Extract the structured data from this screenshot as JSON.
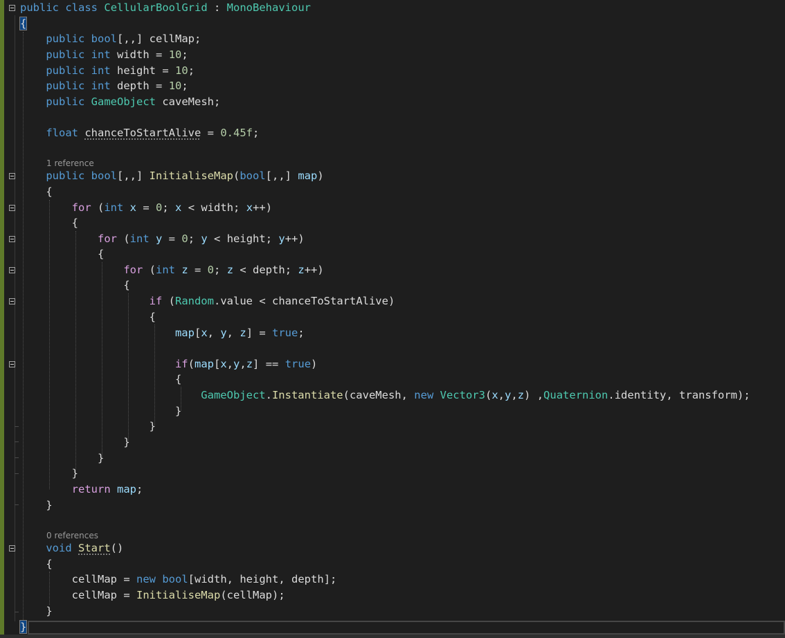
{
  "editor": {
    "theme_colors": {
      "background": "#1e1e1e",
      "keyword": "#569cd6",
      "control": "#d8a0df",
      "type": "#4ec9b0",
      "number": "#b5cea8",
      "method": "#dcdcaa",
      "variable": "#9cdcfe",
      "text": "#dcdcdc"
    },
    "codelens": {
      "initialise_refs": "1 reference",
      "start_refs": "0 references"
    },
    "tokens": {
      "public": "public",
      "class": "class",
      "class_name": "CellularBoolGrid",
      "colon": " : ",
      "base_class": "MonoBehaviour",
      "open_brace": "{",
      "close_brace": "}",
      "bool": "bool",
      "int": "int",
      "float": "float",
      "void": "void",
      "for": "for",
      "if": "if",
      "return": "return",
      "new": "new",
      "true": "true",
      "array3": "[,,]",
      "cellMap": "cellMap",
      "width": "width",
      "height": "height",
      "depth": "depth",
      "GameObject": "GameObject",
      "caveMesh": "caveMesh",
      "chanceToStartAlive": "chanceToStartAlive",
      "n10": "10",
      "n0": "0",
      "n045f": "0.45f",
      "InitialiseMap": "InitialiseMap",
      "map": "map",
      "x": "x",
      "y": "y",
      "z": "z",
      "Random": "Random",
      "value": "value",
      "Instantiate": "Instantiate",
      "Vector3": "Vector3",
      "Quaternion": "Quaternion",
      "identity": "identity",
      "transform": "transform",
      "Start": "Start"
    }
  }
}
